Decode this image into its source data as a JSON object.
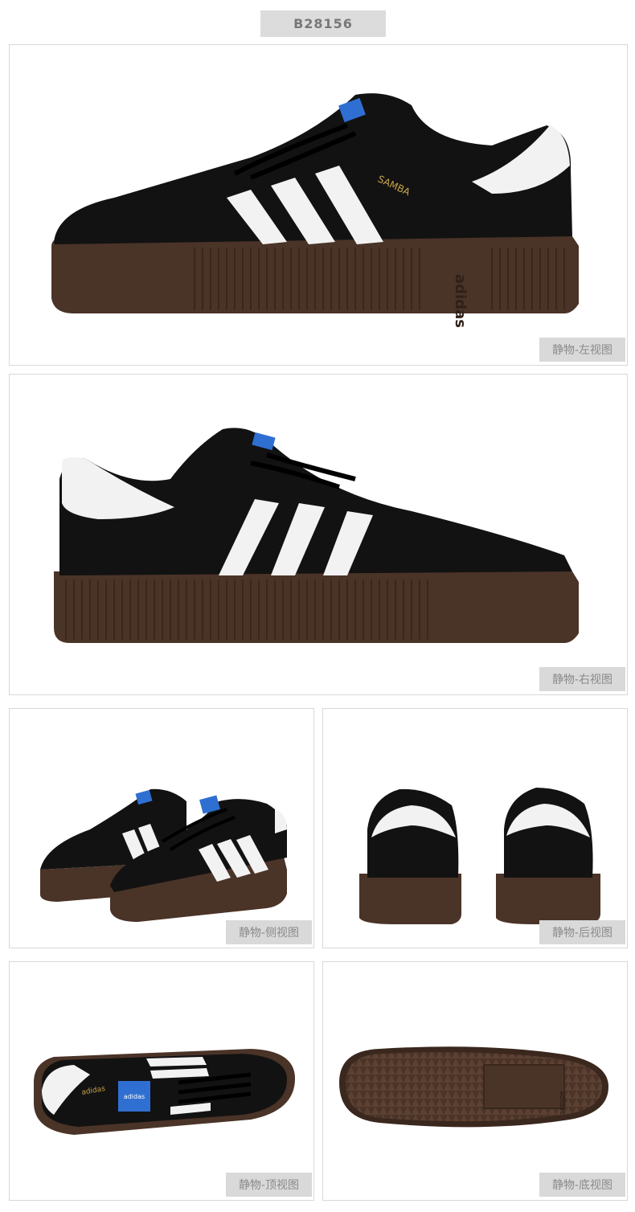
{
  "sku": "B28156",
  "views": {
    "left": "静物-左视图",
    "right": "静物-右视图",
    "side": "静物-侧视图",
    "back": "静物-后视图",
    "top": "静物-顶视图",
    "bottom": "静物-底视图"
  },
  "shoe": {
    "brand_text": "adidas",
    "model_text": "SAMBA"
  },
  "colors": {
    "upper": "#121212",
    "stripes": "#f2f2f2",
    "sole": "#4a3327",
    "label_bg": "#d9d9d9",
    "logo_blue": "#2f6fd1"
  }
}
